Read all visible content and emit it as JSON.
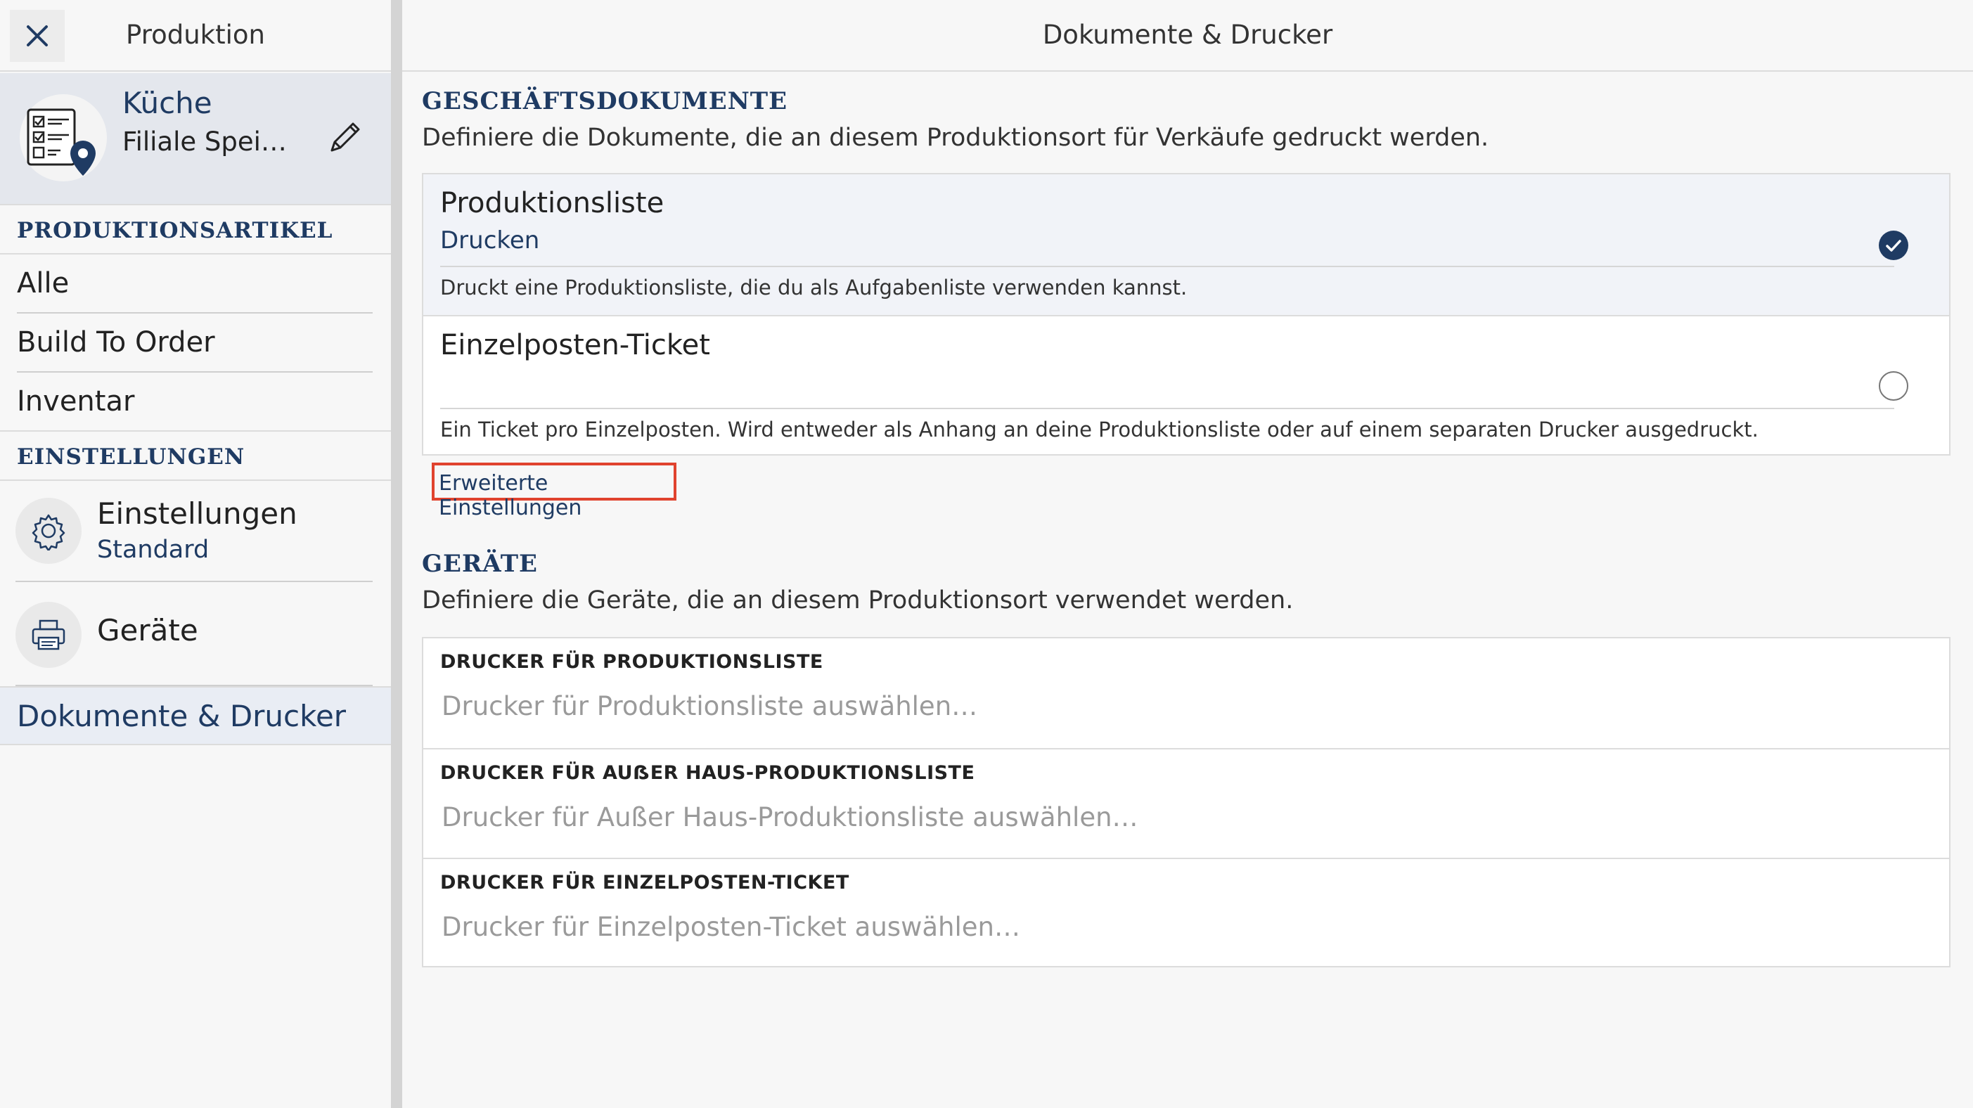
{
  "sidebar": {
    "title": "Produktion",
    "location": {
      "name": "Küche",
      "subtitle": "Filiale Spei…"
    },
    "sections": {
      "production_items": "PRODUKTIONSARTIKEL",
      "settings": "EINSTELLUNGEN"
    },
    "items": [
      "Alle",
      "Build To Order",
      "Inventar"
    ],
    "settings_item": {
      "title": "Einstellungen",
      "subtitle": "Standard"
    },
    "devices_item": {
      "title": "Geräte"
    },
    "active_item": "Dokumente & Drucker"
  },
  "main": {
    "title": "Dokumente & Drucker",
    "business_docs": {
      "heading": "GESCHÄFTSDOKUMENTE",
      "description": "Definiere die Dokumente, die an diesem Produktionsort für Verkäufe gedruckt werden.",
      "items": [
        {
          "name": "Produktionsliste",
          "action": "Drucken",
          "description": "Druckt eine Produktionsliste, die du als Aufgabenliste verwenden kannst.",
          "selected": true
        },
        {
          "name": "Einzelposten-Ticket",
          "action": "",
          "description": "Ein Ticket pro Einzelposten. Wird entweder als Anhang an deine Produktionsliste oder auf einem separaten Drucker ausgedruckt.",
          "selected": false
        }
      ],
      "advanced_link": "Erweiterte Einstellungen"
    },
    "devices": {
      "heading": "GERÄTE",
      "description": "Definiere die Geräte, die an diesem Produktionsort verwendet werden.",
      "rows": [
        {
          "label": "DRUCKER FÜR PRODUKTIONSLISTE",
          "placeholder": "Drucker für Produktionsliste auswählen…"
        },
        {
          "label": "DRUCKER FÜR AUẞER HAUS-PRODUKTIONSLISTE",
          "placeholder": "Drucker für Außer Haus-Produktionsliste auswählen…"
        },
        {
          "label": "DRUCKER FÜR EINZELPOSTEN-TICKET",
          "placeholder": "Drucker für Einzelposten-Ticket auswählen…"
        }
      ]
    }
  },
  "colors": {
    "accent": "#1f3b63",
    "highlight": "#e0432e"
  }
}
